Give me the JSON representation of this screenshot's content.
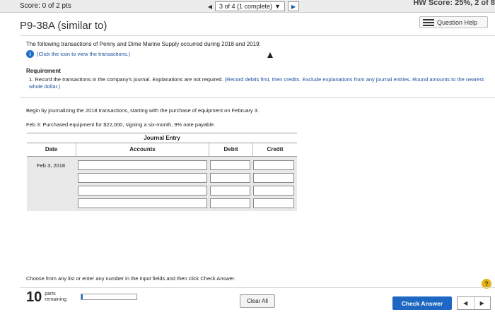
{
  "header": {
    "score": "Score: 0 of 2 pts",
    "counter": "3 of 4 (1 complete)",
    "hw_score": "HW Score: 25%, 2 of 8"
  },
  "question": {
    "title": "P9-38A (similar to)",
    "help_label": "Question Help",
    "intro": "The following transactions of Penny and Dime Marine Supply occurred during 2018 and 2019:",
    "info_link": "(Click the icon to view the transactions.)",
    "requirement_heading": "Requirement",
    "requirement_text": "1. Record the transactions in the company's journal. Explanations are not required.",
    "requirement_note": "(Record debits first, then credits. Exclude explanations from any journal entries. Round amounts to the nearest whole dollar.)",
    "begin_text": "Begin by journalizing the 2018 transactions, starting with the purchase of equipment on February 3.",
    "transaction_text": "Feb 3: Purchased equipment for $22,000, signing a six-month, 9% note payable."
  },
  "journal": {
    "title": "Journal Entry",
    "columns": {
      "date": "Date",
      "accounts": "Accounts",
      "debit": "Debit",
      "credit": "Credit"
    },
    "rows": [
      {
        "date": "Feb 3, 2018",
        "account": "",
        "debit": "",
        "credit": ""
      },
      {
        "date": "",
        "account": "",
        "debit": "",
        "credit": ""
      },
      {
        "date": "",
        "account": "",
        "debit": "",
        "credit": ""
      },
      {
        "date": "",
        "account": "",
        "debit": "",
        "credit": ""
      }
    ]
  },
  "footer": {
    "instruction": "Choose from any list or enter any number in the input fields and then click Check Answer.",
    "parts_count": "10",
    "parts_label_1": "parts",
    "parts_label_2": "remaining",
    "progress_fraction": 0.02,
    "clear_label": "Clear All",
    "check_label": "Check Answer",
    "help_icon": "question-icon"
  },
  "colors": {
    "accent": "#1e67c2",
    "help_badge": "#e3b418"
  }
}
